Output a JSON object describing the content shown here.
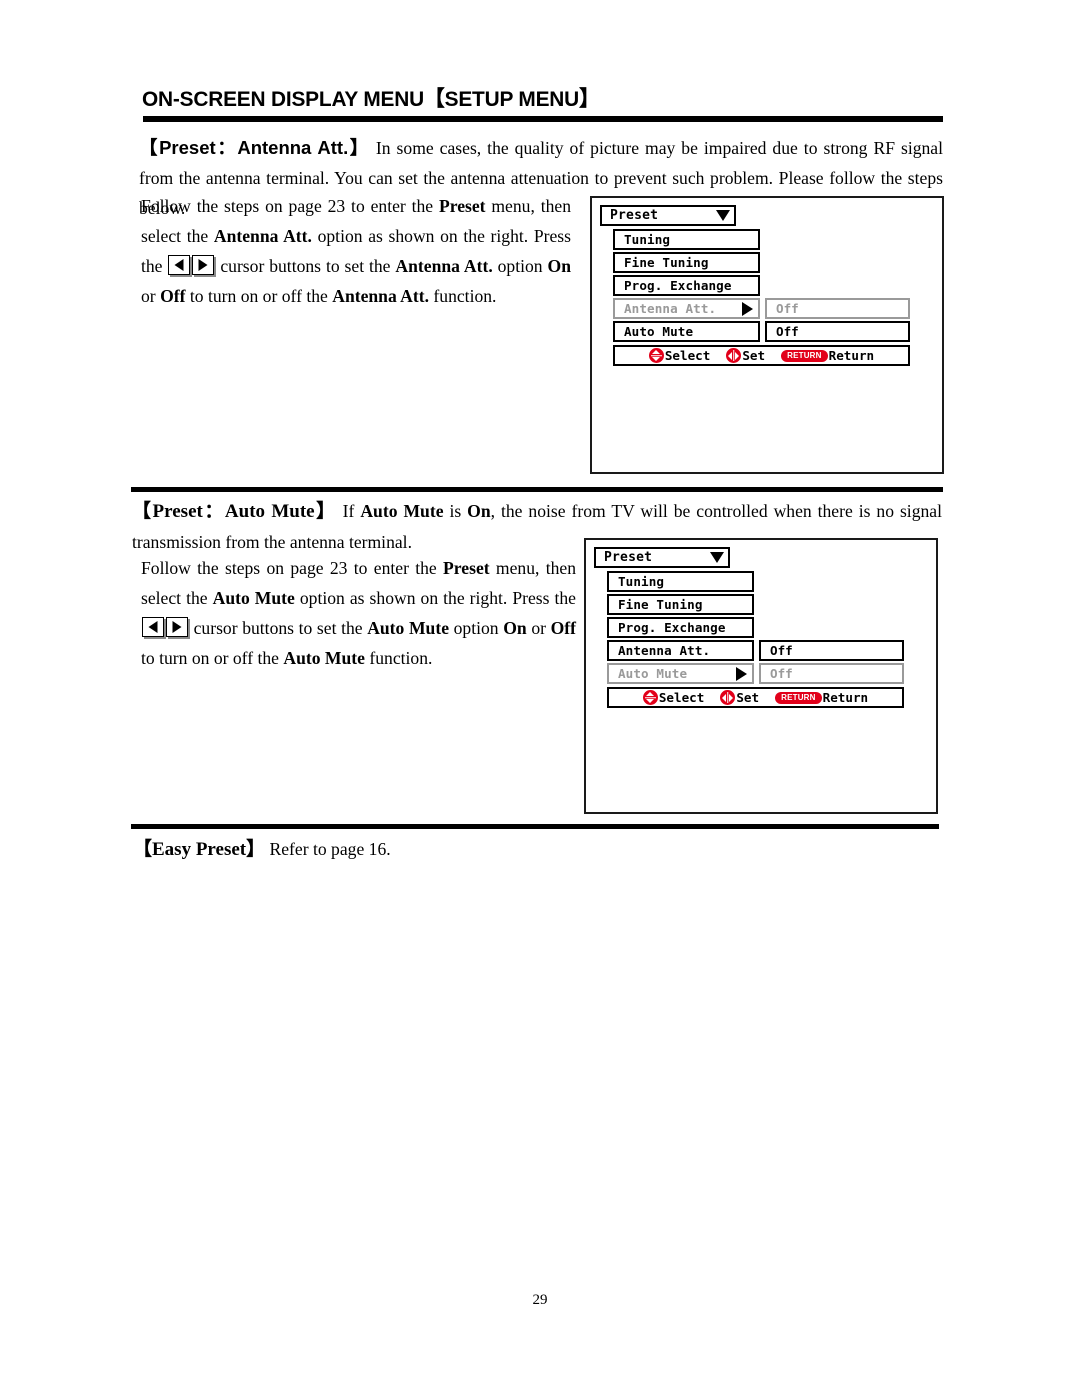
{
  "document": {
    "title": "ON-SCREEN DISPLAY MENU【SETUP MENU】",
    "page_number": "29"
  },
  "sections": {
    "antenna_att": {
      "lead": "【Preset：Antenna Att.】",
      "intro_rest": " In some cases, the quality of picture may be impaired due to strong RF signal from the antenna terminal. You can set the antenna attenuation to prevent such problem. Please follow the steps below.",
      "steps": {
        "p1_a": "Follow the steps on page 23 to enter the ",
        "p1_b": "Preset",
        "p1_c": " menu, then select the ",
        "p1_d": "Antenna Att.",
        "p1_e": " option as shown on the right.",
        "p2_a": "Press the ",
        "p2_b": " cursor buttons to set the ",
        "p2_c": "Antenna Att.",
        "p2_d": " option ",
        "p2_e": "On",
        "p2_f": " or ",
        "p2_g": "Off",
        "p2_h": " to turn on or off the ",
        "p2_i": "Antenna Att.",
        "p2_j": " function."
      }
    },
    "auto_mute": {
      "lead": "【Preset：Auto Mute】",
      "intro_a": " If ",
      "intro_b": "Auto Mute",
      "intro_c": " is ",
      "intro_d": "On",
      "intro_e": ", the noise from TV will be controlled when there is no signal transmission from the antenna terminal.",
      "steps": {
        "p1_a": "Follow the steps on page 23 to enter the ",
        "p1_b": "Preset",
        "p1_c": " menu, then select the ",
        "p1_d": "Auto Mute",
        "p1_e": " option as shown on the right.",
        "p2_a": "Press the ",
        "p2_b": " cursor buttons to set the ",
        "p2_c": "Auto Mute",
        "p2_d": " option ",
        "p2_e": "On",
        "p2_f": " or ",
        "p2_g": "Off",
        "p2_h": " to turn on or off the ",
        "p2_i": "Auto Mute",
        "p2_j": " function."
      }
    },
    "easy_preset": {
      "lead": "【Easy Preset】",
      "rest": " Refer to page 16."
    }
  },
  "osd_menu_1": {
    "header_label": "Preset",
    "header_caret": "caret-down-icon",
    "rows": [
      {
        "label": "Tuning",
        "value": "",
        "selected": false,
        "has_arrow": false,
        "has_value_box": false
      },
      {
        "label": "Fine Tuning",
        "value": "",
        "selected": false,
        "has_arrow": false,
        "has_value_box": false
      },
      {
        "label": "Prog. Exchange",
        "value": "",
        "selected": false,
        "has_arrow": false,
        "has_value_box": false
      },
      {
        "label": "Antenna Att.",
        "value": "Off",
        "selected": true,
        "has_arrow": true,
        "has_value_box": true
      },
      {
        "label": "Auto Mute",
        "value": "Off",
        "selected": false,
        "has_arrow": false,
        "has_value_box": true
      }
    ],
    "footer": {
      "select_label": "Select",
      "set_label": "Set",
      "return_badge": "RETURN",
      "return_label": "Return"
    }
  },
  "osd_menu_2": {
    "header_label": "Preset",
    "header_caret": "caret-down-icon",
    "rows": [
      {
        "label": "Tuning",
        "value": "",
        "selected": false,
        "has_arrow": false,
        "has_value_box": false
      },
      {
        "label": "Fine Tuning",
        "value": "",
        "selected": false,
        "has_arrow": false,
        "has_value_box": false
      },
      {
        "label": "Prog. Exchange",
        "value": "",
        "selected": false,
        "has_arrow": false,
        "has_value_box": false
      },
      {
        "label": "Antenna Att.",
        "value": "Off",
        "selected": false,
        "has_arrow": false,
        "has_value_box": true
      },
      {
        "label": "Auto Mute",
        "value": "Off",
        "selected": true,
        "has_arrow": true,
        "has_value_box": true
      }
    ],
    "footer": {
      "select_label": "Select",
      "set_label": "Set",
      "return_badge": "RETURN",
      "return_label": "Return"
    }
  },
  "colors": {
    "accent_red": "#e2001a",
    "text": "#000000",
    "dim": "#9a9a9a"
  }
}
